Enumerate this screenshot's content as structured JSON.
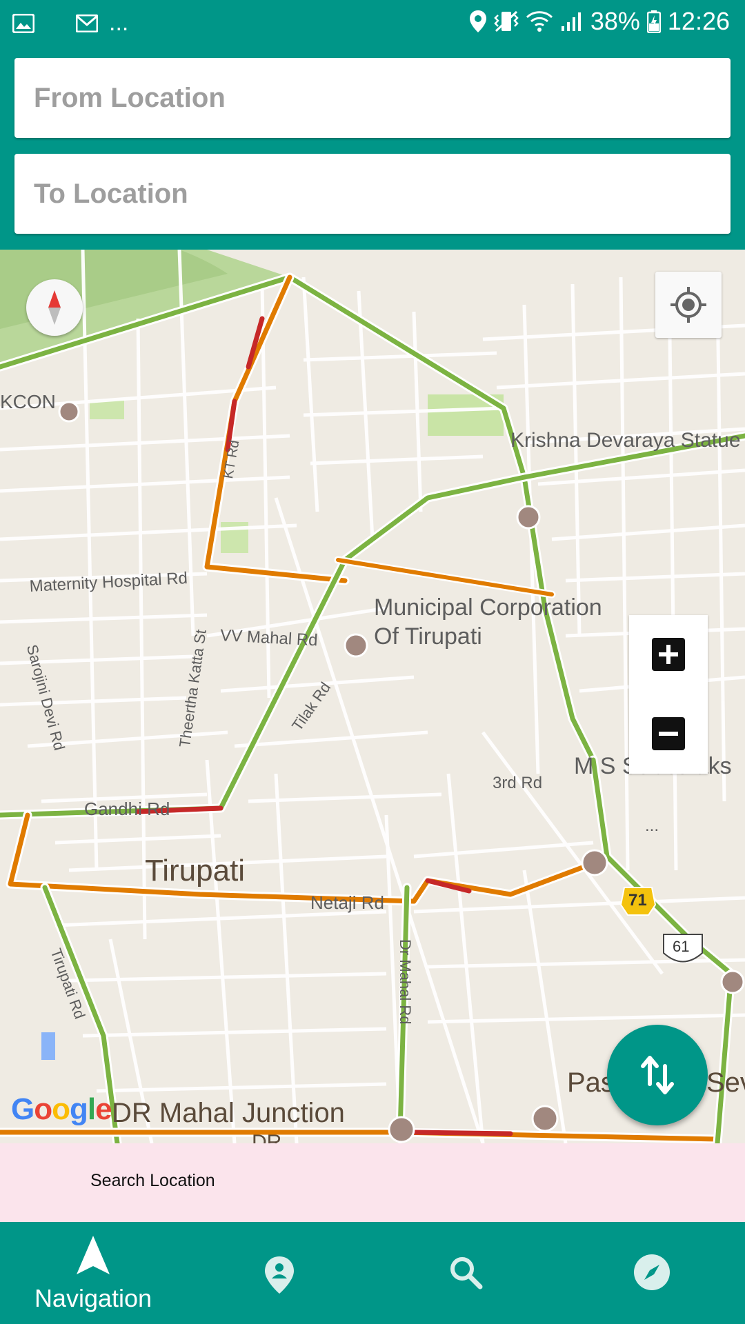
{
  "status_bar": {
    "battery": "38%",
    "time": "12:26",
    "overflow": "...",
    "left_icons": [
      "gallery-icon",
      "mail-icon"
    ],
    "right_icons": [
      "location-icon",
      "vibrate-icon",
      "wifi-icon",
      "signal-icon",
      "battery-icon"
    ]
  },
  "inputs": {
    "from_placeholder": "From Location",
    "to_placeholder": "To Location"
  },
  "map": {
    "labels": {
      "iskcon": "KCON",
      "krishna": "Krishna Devaraya Statue",
      "maternity": "Maternity Hospital Rd",
      "municipal_1": "Municipal Corporation",
      "municipal_2": "Of Tirupati",
      "vv_mahal": "VV Mahal Rd",
      "sarojini": "Sarojini Devi Rd",
      "theertha": "Theertha Katta St",
      "tilak": "Tilak Rd",
      "kt_rd": "KT Rd",
      "third_rd": "3rd Rd",
      "ms": "M S Subbulaks",
      "gandhi": "Gandhi Rd",
      "tirupati": "Tirupati",
      "netaji": "Netaji Rd",
      "dr_mahal_rd": "Dr Mahal Rd",
      "tirupati_rd": "Tirupati Rd",
      "dr_mahal_junction": "DR Mahal Junction",
      "dr_partial": "DR",
      "pas": "Pas",
      "sev": "Sev",
      "dots": "...",
      "shield_71": "71",
      "shield_61": "61"
    },
    "google_logo": "Google",
    "colors": {
      "traffic_green": "#7cb342",
      "traffic_orange": "#e07b00",
      "traffic_red": "#c62828"
    }
  },
  "search": {
    "label": "Search Location"
  },
  "nav": {
    "items": [
      {
        "label": "Navigation",
        "icon": "navigation-arrow-icon"
      },
      {
        "label": "",
        "icon": "place-pin-icon"
      },
      {
        "label": "",
        "icon": "search-icon"
      },
      {
        "label": "",
        "icon": "compass-icon"
      }
    ]
  },
  "theme": {
    "primary": "#009688",
    "search_bg": "#fbe4ec"
  }
}
